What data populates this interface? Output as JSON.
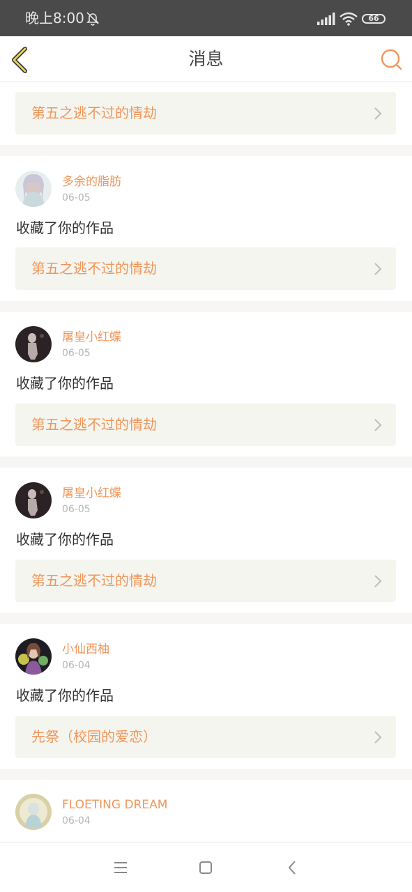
{
  "status_bar": {
    "time": "晚上8:00",
    "battery": "66",
    "mute_icon": "bell-off-icon",
    "signal_icon": "cell-signal-icon",
    "wifi_icon": "wifi-icon",
    "battery_icon": "battery-icon"
  },
  "header": {
    "title": "消息",
    "back_icon": "chevron-left-icon",
    "search_icon": "search-icon"
  },
  "colors": {
    "accent": "#f0965a",
    "card_bg": "#f5f5ef",
    "divider": "#f7f6f4",
    "status_bar": "#4a4a4a",
    "text_primary": "#333333",
    "text_secondary": "#b5b5b5"
  },
  "messages": [
    {
      "work_title": "第五之逃不过的情劫"
    },
    {
      "user": "多余的脂肪",
      "date": "06-05",
      "action": "收藏了你的作品",
      "work_title": "第五之逃不过的情劫"
    },
    {
      "user": "屠皇小红蝶",
      "date": "06-05",
      "action": "收藏了你的作品",
      "work_title": "第五之逃不过的情劫"
    },
    {
      "user": "屠皇小红蝶",
      "date": "06-05",
      "action": "收藏了你的作品",
      "work_title": "第五之逃不过的情劫"
    },
    {
      "user": "小仙西柚",
      "date": "06-04",
      "action": "收藏了你的作品",
      "work_title": "先祭（校园的爱恋）"
    },
    {
      "user": "FLOETING DREAM",
      "date": "06-04"
    }
  ],
  "nav_bar": {
    "menu_icon": "menu-icon",
    "home_icon": "square-home-icon",
    "back_icon": "triangle-back-icon"
  }
}
